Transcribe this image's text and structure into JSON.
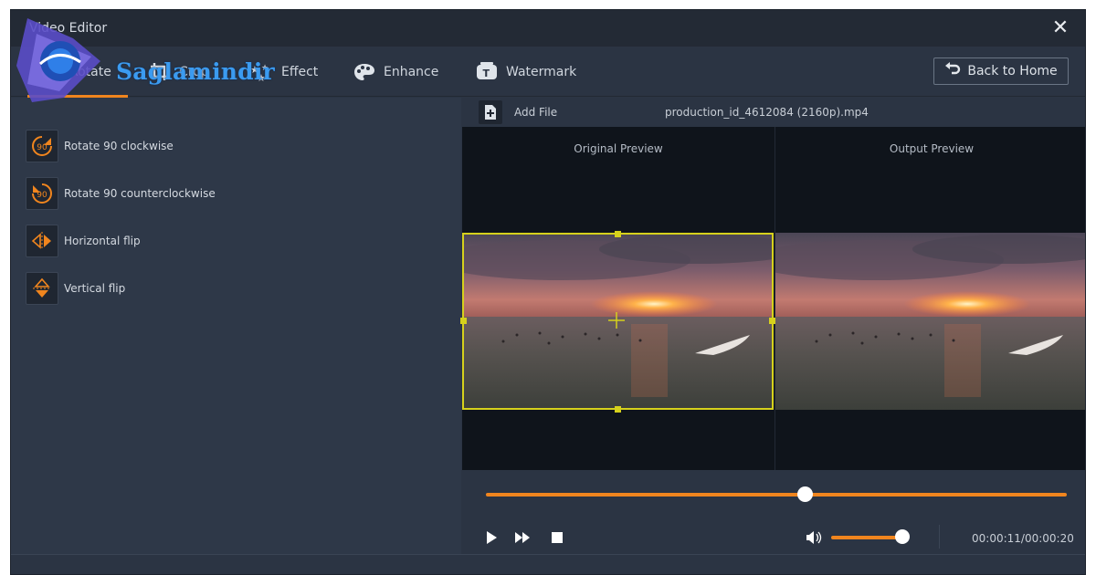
{
  "window": {
    "title": "Video Editor",
    "close_symbol": "✕"
  },
  "toolbar": {
    "tabs": [
      {
        "label": "Rotate",
        "icon": "rotate-icon",
        "active": true
      },
      {
        "label": "Crop",
        "icon": "crop-icon",
        "active": false
      },
      {
        "label": "Effect",
        "icon": "effect-stars-icon",
        "active": false
      },
      {
        "label": "Enhance",
        "icon": "palette-icon",
        "active": false
      },
      {
        "label": "Watermark",
        "icon": "watermark-icon",
        "active": false
      }
    ],
    "back_label": "Back to Home"
  },
  "rotate_options": [
    {
      "label": "Rotate 90 clockwise",
      "icon": "rotate-cw-90-icon",
      "badge": "90"
    },
    {
      "label": "Rotate 90 counterclockwise",
      "icon": "rotate-ccw-90-icon",
      "badge": "90"
    },
    {
      "label": "Horizontal flip",
      "icon": "horizontal-flip-icon"
    },
    {
      "label": "Vertical flip",
      "icon": "vertical-flip-icon"
    }
  ],
  "file": {
    "add_label": "Add File",
    "name": "production_id_4612084 (2160p).mp4"
  },
  "preview": {
    "original_label": "Original Preview",
    "output_label": "Output Preview"
  },
  "playback": {
    "position_fraction": 0.55,
    "volume_fraction": 0.9,
    "timecode": "00:00:11/00:00:20"
  },
  "watermark_logo": {
    "text": "Saglamindir"
  },
  "colors": {
    "accent": "#f0851e",
    "crop_box": "#d6d11c",
    "panel": "#2e3848",
    "titlebar": "#232a35"
  }
}
